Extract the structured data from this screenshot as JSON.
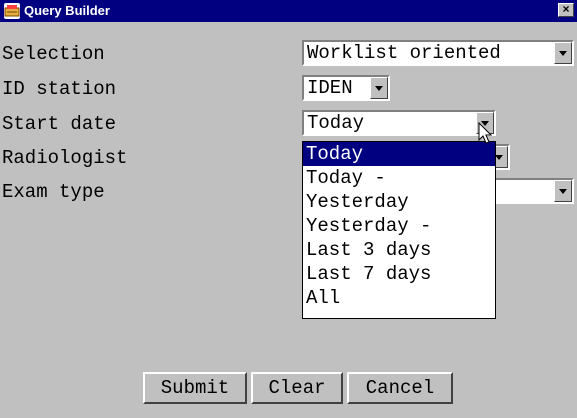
{
  "window": {
    "title": "Query Builder",
    "close_glyph": "×"
  },
  "form": {
    "rows": [
      {
        "label": "Selection",
        "value": "Worklist oriented"
      },
      {
        "label": "ID station",
        "value": "IDEN"
      },
      {
        "label": "Start date",
        "value": "Today"
      },
      {
        "label": "Radiologist",
        "value": ""
      },
      {
        "label": "Exam type",
        "value": ""
      }
    ]
  },
  "dropdown": {
    "options": [
      "Today",
      "Today -",
      "Yesterday",
      "Yesterday -",
      "Last 3 days",
      "Last 7 days",
      "All"
    ],
    "selected": "Today"
  },
  "buttons": {
    "submit": "Submit",
    "clear": "Clear",
    "cancel": "Cancel"
  },
  "colors": {
    "titlebar": "#000080",
    "window_bg": "#c0c0c0",
    "selection": "#000080"
  }
}
